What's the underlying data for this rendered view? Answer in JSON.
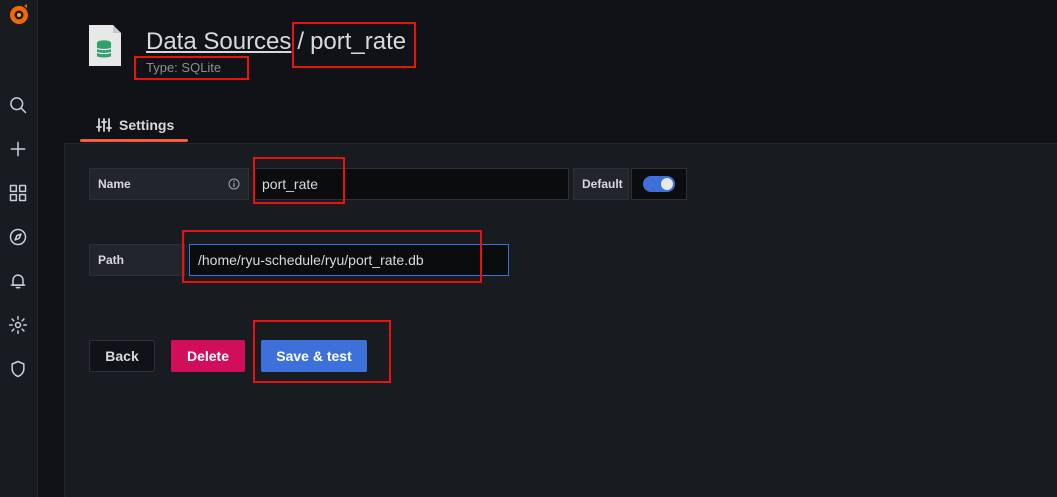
{
  "header": {
    "breadcrumb": "Data Sources",
    "separator": "/",
    "title": "port_rate",
    "subtitle": "Type: SQLite"
  },
  "tabs": [
    {
      "label": "Settings"
    }
  ],
  "form": {
    "name_label": "Name",
    "name_value": "port_rate",
    "default_label": "Default",
    "default_on": true,
    "path_label": "Path",
    "path_value": "/home/ryu-schedule/ryu/port_rate.db"
  },
  "buttons": {
    "back": "Back",
    "delete": "Delete",
    "save": "Save & test"
  },
  "sidebar": {
    "icons": [
      "grafana-logo-icon",
      "search-icon",
      "plus-icon",
      "dashboards-icon",
      "explore-icon",
      "bell-icon",
      "gear-icon",
      "shield-icon"
    ]
  },
  "colors": {
    "accent": "#3d71d9",
    "danger": "#d10e5c",
    "tab_underline": "#f55f3e",
    "annotation": "#e8130f"
  }
}
